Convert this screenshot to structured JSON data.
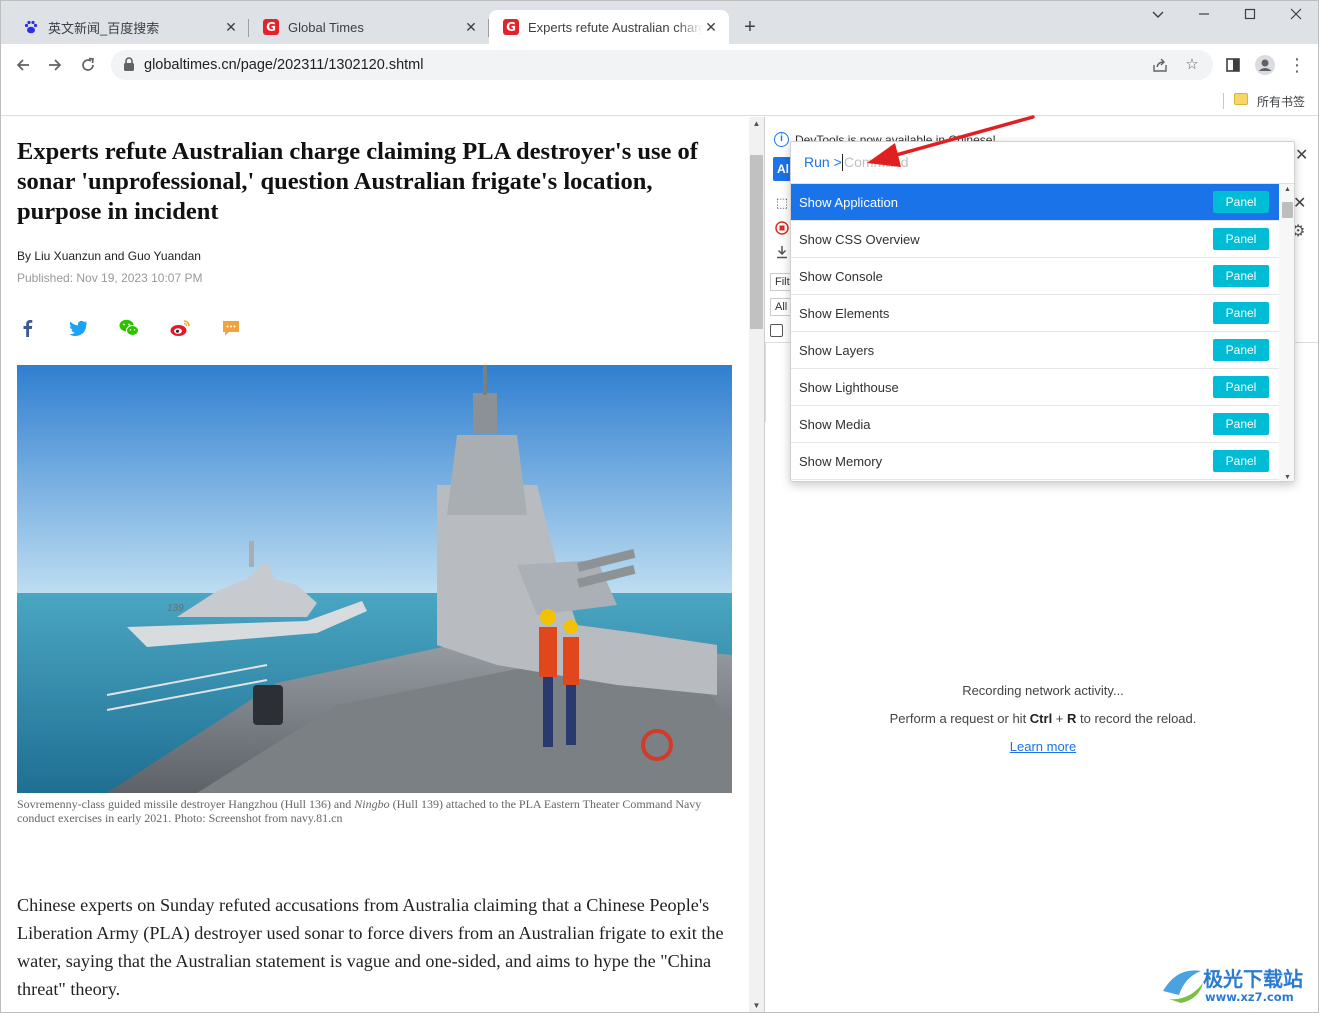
{
  "tabs": [
    {
      "title": "英文新闻_百度搜索",
      "favicon": "baidu-paw-icon"
    },
    {
      "title": "Global Times",
      "favicon": "globaltimes-g-icon"
    },
    {
      "title": "Experts refute Australian charge claiming PLA destroyer's use of sonar",
      "favicon": "globaltimes-g-icon"
    }
  ],
  "address_bar": {
    "url": "globaltimes.cn/page/202311/1302120.shtml"
  },
  "bookmarks": {
    "folder_label": "所有书签"
  },
  "article": {
    "headline": "Experts refute Australian charge claiming PLA destroyer's use of sonar 'unprofessional,' question Australian frigate's location, purpose in incident",
    "byline": "By Liu Xuanzun and Guo Yuandan",
    "published": "Published: Nov 19, 2023 10:07 PM",
    "share_icons": [
      "facebook-icon",
      "twitter-icon",
      "wechat-icon",
      "weibo-icon",
      "comment-icon"
    ],
    "caption_part1": "Sovremenny-class guided missile destroyer Hangzhou (Hull 136) and ",
    "caption_italic": "Ningbo",
    "caption_part2": " (Hull 139) attached to the PLA Eastern Theater Command Navy conduct exercises in early 2021. Photo: Screenshot from navy.81.cn",
    "body": "Chinese experts on Sunday refuted accusations from Australia claiming that a Chinese People's Liberation Army (PLA) destroyer used sonar to force divers from an Australian frigate to exit the water, saying that the Australian statement is vague and one-sided, and aims to hype the \"China threat\" theory."
  },
  "devtools": {
    "info_text": "DevTools is now available in Chinese!",
    "blue_button": "Al",
    "filter_placeholder": "Filt",
    "all_label": "All",
    "status": "Recording network activity...",
    "hint_prefix": "Perform a request or hit ",
    "hint_key1": "Ctrl",
    "hint_plus": " + ",
    "hint_key2": "R",
    "hint_suffix": " to record the reload.",
    "learn_more": "Learn more"
  },
  "command_menu": {
    "prefix": "Run >",
    "placeholder": "Command",
    "items": [
      {
        "label": "Show Application",
        "badge": "Panel"
      },
      {
        "label": "Show CSS Overview",
        "badge": "Panel"
      },
      {
        "label": "Show Console",
        "badge": "Panel"
      },
      {
        "label": "Show Elements",
        "badge": "Panel"
      },
      {
        "label": "Show Layers",
        "badge": "Panel"
      },
      {
        "label": "Show Lighthouse",
        "badge": "Panel"
      },
      {
        "label": "Show Media",
        "badge": "Panel"
      },
      {
        "label": "Show Memory",
        "badge": "Panel"
      }
    ],
    "selected_index": 0
  },
  "watermark": {
    "name": "极光下载站",
    "url": "www.xz7.com"
  },
  "colors": {
    "accent": "#1a73e8",
    "badge": "#00bcd4",
    "annotation_arrow": "#e02020"
  }
}
